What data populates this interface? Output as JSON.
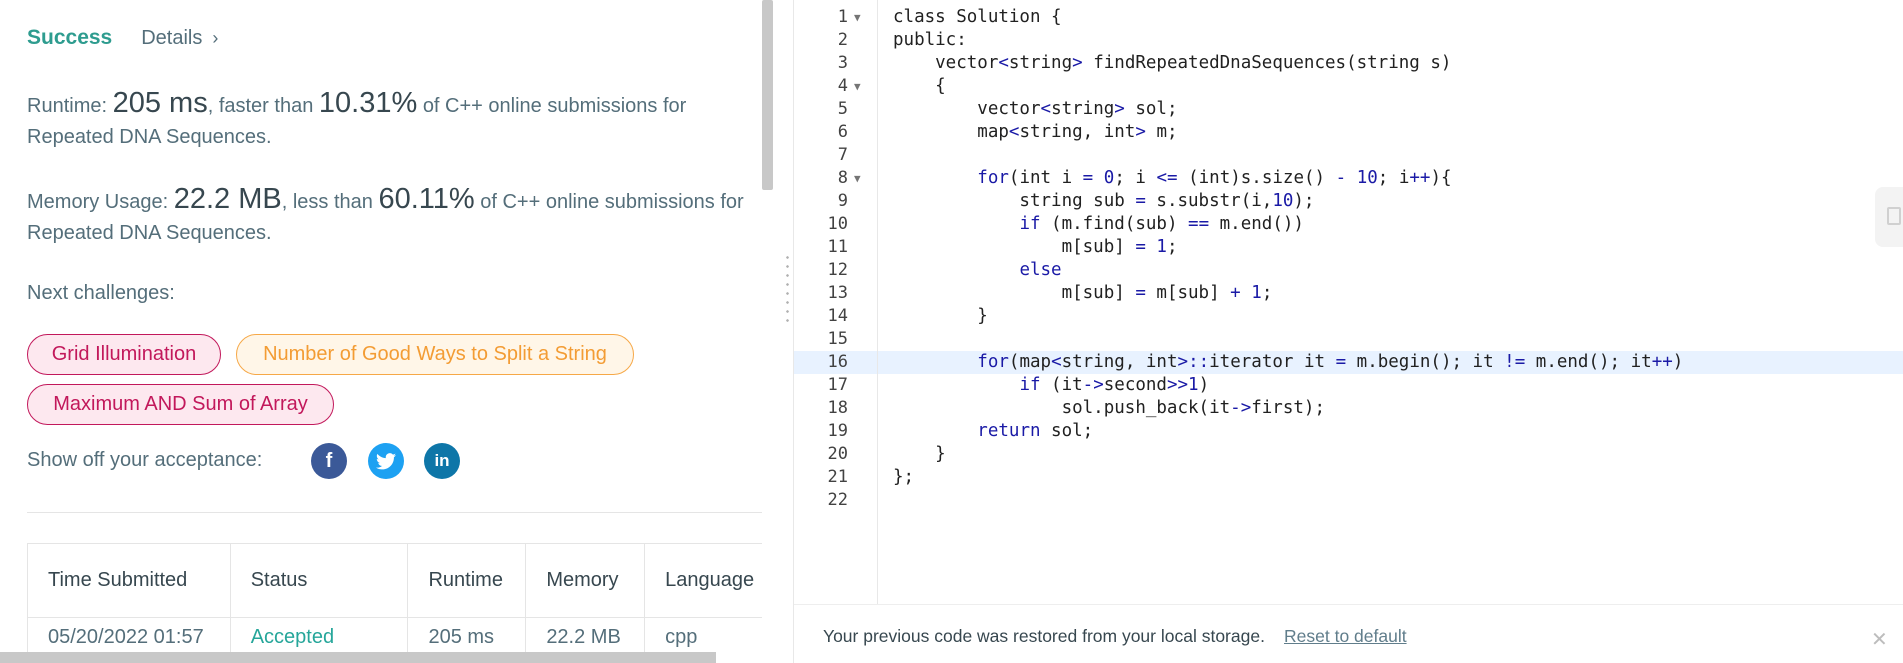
{
  "result": {
    "status": "Success",
    "details_label": "Details",
    "details_chevron": "›"
  },
  "runtime": {
    "label": "Runtime:",
    "value": "205 ms",
    "comparison_text": ", faster than",
    "percent": "10.31%",
    "suffix": "of C++ online submissions for",
    "problem": "Repeated DNA Sequences."
  },
  "memory": {
    "label": "Memory Usage:",
    "value": "22.2 MB",
    "comparison_text": ", less than",
    "percent": "60.11%",
    "suffix": "of C++ online submissions for",
    "problem": "Repeated DNA Sequences."
  },
  "next_challenges": {
    "label": "Next challenges:",
    "items": [
      {
        "label": "Grid Illumination",
        "difficulty": "hard"
      },
      {
        "label": "Number of Good Ways to Split a String",
        "difficulty": "medium"
      },
      {
        "label": "Maximum AND Sum of Array",
        "difficulty": "hard"
      }
    ]
  },
  "share": {
    "label": "Show off your acceptance:",
    "icons": [
      "facebook-icon",
      "twitter-icon",
      "linkedin-icon"
    ],
    "glyphs": {
      "facebook": "f",
      "twitter": "🐦",
      "linkedin": "in"
    }
  },
  "submissions_table": {
    "headers": [
      "Time Submitted",
      "Status",
      "Runtime",
      "Memory",
      "Language"
    ],
    "rows": [
      [
        "05/20/2022 01:57",
        "Accepted",
        "205 ms",
        "22.2 MB",
        "cpp"
      ]
    ]
  },
  "editor": {
    "lines": [
      "class Solution {",
      "public:",
      "    vector<string> findRepeatedDnaSequences(string s)",
      "    {",
      "        vector<string> sol;",
      "        map<string, int> m;",
      "",
      "        for(int i = 0; i <= (int)s.size() - 10; i++){",
      "            string sub = s.substr(i,10);",
      "            if (m.find(sub) == m.end())",
      "                m[sub] = 1;",
      "            else",
      "                m[sub] = m[sub] + 1;",
      "        }",
      "",
      "        for(map<string, int>::iterator it = m.begin(); it != m.end(); it++)",
      "            if (it->second>>1)",
      "                sol.push_back(it->first);",
      "        return sol;",
      "    }",
      "};",
      ""
    ],
    "fold_lines": [
      1,
      4,
      8
    ],
    "active_line": 16
  },
  "footer": {
    "message": "Your previous code was restored from your local storage.",
    "reset_label": "Reset to default",
    "close_glyph": "✕"
  },
  "colors": {
    "success": "#2e9c8f",
    "hard": "#c2185b",
    "medium": "#f39c34",
    "keyword": "#1a1aa6",
    "active_line_bg": "#e8f2ff"
  }
}
